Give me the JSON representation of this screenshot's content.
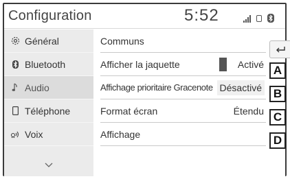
{
  "header": {
    "title": "Configuration",
    "clock": "5:52"
  },
  "sidebar": {
    "items": [
      {
        "label": "Général",
        "icon": "gear-icon"
      },
      {
        "label": "Bluetooth",
        "icon": "bluetooth-icon"
      },
      {
        "label": "Audio",
        "icon": "music-note-icon"
      },
      {
        "label": "Téléphone",
        "icon": "phone-icon"
      },
      {
        "label": "Voix",
        "icon": "voice-icon"
      }
    ],
    "active_index": 2
  },
  "main": {
    "section_title": "Communs",
    "rows": [
      {
        "label": "Afficher la jaquette",
        "value": "Activé",
        "callout": "A"
      },
      {
        "label": "Affichage prioritaire Gracenote",
        "value": "Désactivé",
        "callout": "B"
      },
      {
        "label": "Format écran",
        "value": "Étendu",
        "callout": "C"
      },
      {
        "label": "Affichage",
        "value": "",
        "callout": "D"
      }
    ]
  },
  "colors": {
    "sidebar_bg": "#ebebeb",
    "sidebar_active_bg": "#dcdcdc",
    "frame": "#3a3a3a",
    "indicator_on": "#555555",
    "indicator_off": "#bbbbbb"
  }
}
